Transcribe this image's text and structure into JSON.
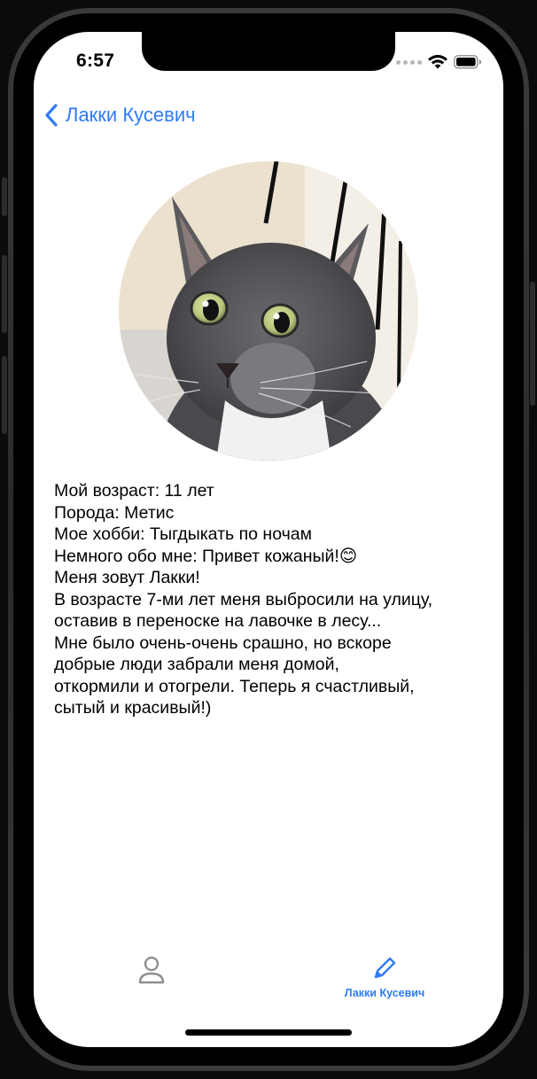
{
  "status_bar": {
    "time": "6:57"
  },
  "nav": {
    "back_label": "Лакки Кусевич"
  },
  "profile": {
    "bio_lines": [
      "Мой возраст: 11 лет",
      "Порода: Метис",
      "Мое хобби: Тыгдыкать по ночам",
      "Немного обо мне: Привет кожаный!😊",
      "Меня зовут Лакки!",
      "В возрасте 7-ми лет меня выбросили на улицу,",
      "оставив в переноске на лавочке в лесу...",
      "Мне было очень-очень срашно, но вскоре",
      "добрые люди забрали меня домой,",
      "откормили и отогрели. Теперь я счастливый,",
      "сытый и красивый!)"
    ]
  },
  "tabbar": {
    "tabs": [
      {
        "icon": "person-icon",
        "label": ""
      },
      {
        "icon": "pencil-icon",
        "label": "Лакки Кусевич"
      }
    ]
  },
  "colors": {
    "accent": "#2f7cf6",
    "inactive_icon": "#8e8e93",
    "background": "#ffffff"
  }
}
